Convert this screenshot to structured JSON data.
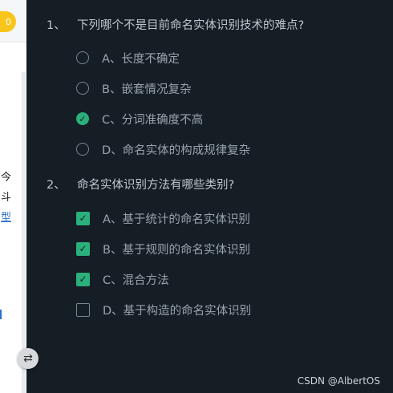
{
  "left": {
    "badge": "0",
    "fragments": [
      "今",
      "斗",
      "型"
    ],
    "swap_icon": "swap-horizontal-icon"
  },
  "questions": [
    {
      "number": "1、",
      "text": "下列哪个不是目前命名实体识别技术的难点?",
      "type": "radio",
      "options": [
        {
          "label": "A、长度不确定",
          "checked": false
        },
        {
          "label": "B、嵌套情况复杂",
          "checked": false
        },
        {
          "label": "C、分词准确度不高",
          "checked": true
        },
        {
          "label": "D、命名实体的构成规律复杂",
          "checked": false
        }
      ]
    },
    {
      "number": "2、",
      "text": "命名实体识别方法有哪些类别?",
      "type": "checkbox",
      "options": [
        {
          "label": "A、基于统计的命名实体识别",
          "checked": true
        },
        {
          "label": "B、基于规则的命名实体识别",
          "checked": true
        },
        {
          "label": "C、混合方法",
          "checked": true
        },
        {
          "label": "D、基于构造的命名实体识别",
          "checked": false
        }
      ]
    }
  ],
  "watermark": "CSDN @AlbertOS",
  "colors": {
    "accent": "#2bb07b",
    "panel_bg": "#151d25",
    "badge": "#f8c51c"
  }
}
